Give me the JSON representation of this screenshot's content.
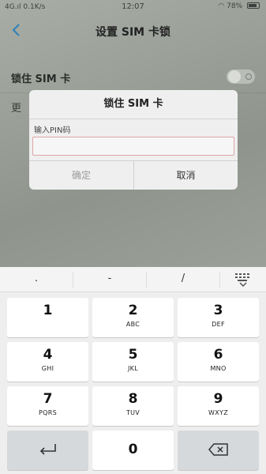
{
  "status_bar": {
    "left": "4G.ıl  0.1K/s",
    "time": "12:07",
    "right": "78%"
  },
  "header": {
    "title": "设置 SIM 卡锁"
  },
  "settings": {
    "lock_sim_label": "锁住 SIM 卡",
    "lock_sim_enabled": false,
    "row2_partial_label": "更"
  },
  "dialog": {
    "title": "锁住 SIM 卡",
    "pin_label": "输入PIN码",
    "pin_value": "",
    "ok_label": "确定",
    "cancel_label": "取消"
  },
  "keyboard": {
    "symbols": [
      ".",
      "-",
      "/"
    ],
    "keys": [
      {
        "digit": "1",
        "letters": ""
      },
      {
        "digit": "2",
        "letters": "ABC"
      },
      {
        "digit": "3",
        "letters": "DEF"
      },
      {
        "digit": "4",
        "letters": "GHI"
      },
      {
        "digit": "5",
        "letters": "JKL"
      },
      {
        "digit": "6",
        "letters": "MNO"
      },
      {
        "digit": "7",
        "letters": "PQRS"
      },
      {
        "digit": "8",
        "letters": "TUV"
      },
      {
        "digit": "9",
        "letters": "WXYZ"
      },
      {
        "digit": "0",
        "letters": ""
      }
    ]
  }
}
